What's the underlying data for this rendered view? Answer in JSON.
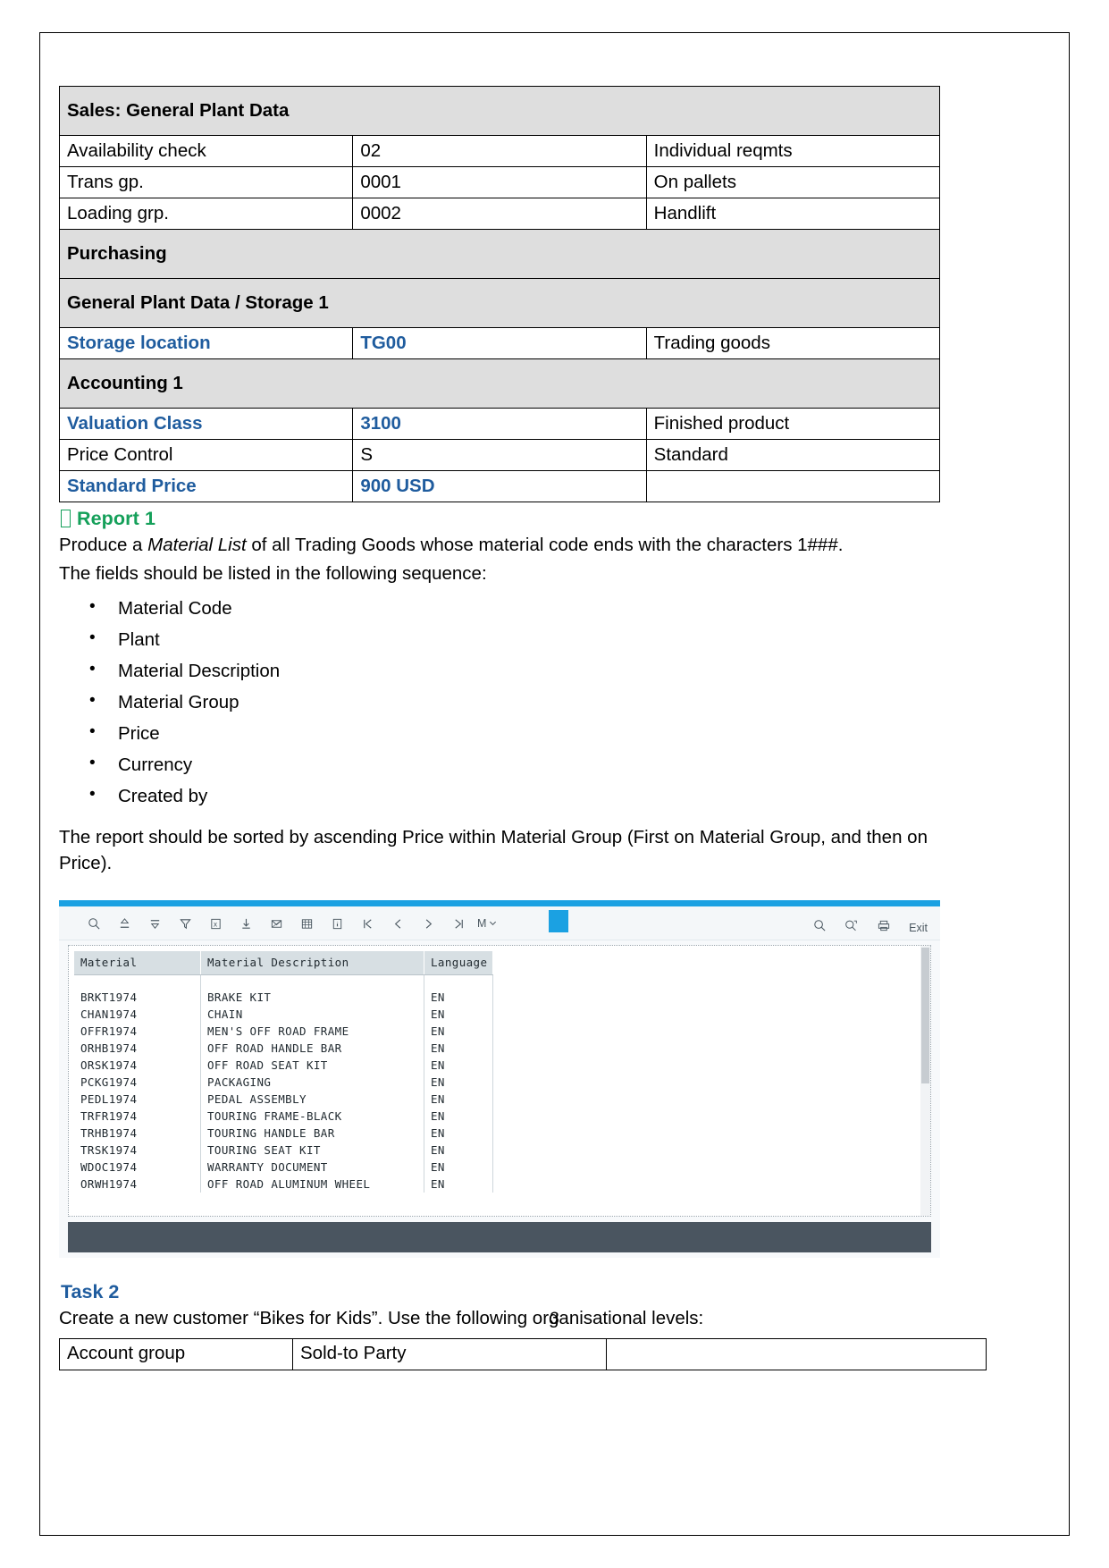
{
  "document": {
    "page_number": "3"
  },
  "plant_table": {
    "sections": {
      "sales": "Sales: General Plant Data",
      "purchasing": "Purchasing",
      "storage": "General Plant Data / Storage 1",
      "accounting": "Accounting 1"
    },
    "rows": [
      {
        "label": "Availability check",
        "value": "02",
        "desc": "Individual reqmts",
        "label_blue": false,
        "value_blue": false
      },
      {
        "label": "Trans gp.",
        "value": "0001",
        "desc": "On pallets",
        "label_blue": false,
        "value_blue": false
      },
      {
        "label": "Loading grp.",
        "value": "0002",
        "desc": "Handlift",
        "label_blue": false,
        "value_blue": false
      },
      {
        "label": "Storage location",
        "value": "TG00",
        "desc": "Trading goods",
        "label_blue": true,
        "value_blue": true
      },
      {
        "label": "Valuation Class",
        "value": "3100",
        "desc": "Finished product",
        "label_blue": true,
        "value_blue": true
      },
      {
        "label": "Price Control",
        "value": "S",
        "desc": "Standard",
        "label_blue": false,
        "value_blue": false
      },
      {
        "label": "Standard Price",
        "value": "900 USD",
        "desc": "",
        "label_blue": true,
        "value_blue": true
      }
    ]
  },
  "report": {
    "heading": "Report 1",
    "paragraph_line1_pre": "Produce a ",
    "paragraph_italic": "Material List",
    "paragraph_line1_post": " of all Trading Goods whose material code ends with the characters 1###.",
    "paragraph_line2": "The fields should be listed in the following sequence:",
    "fields": [
      "Material Code",
      "Plant",
      "Material Description",
      "Material Group",
      "Price",
      "Currency",
      "Created by"
    ],
    "sort_note": "The report should be sorted by ascending Price within Material Group (First on Material Group, and then on Price)."
  },
  "sap_screenshot": {
    "toolbar": {
      "more_label": "M",
      "exit_label": "Exit",
      "icons": [
        "magnifier-icon",
        "sort-ascending-icon",
        "sort-descending-icon",
        "filter-icon",
        "spreadsheet-icon",
        "download-icon",
        "mail-icon",
        "grid-icon",
        "info-icon",
        "first-page-icon",
        "previous-page-icon",
        "next-page-icon",
        "last-page-icon"
      ],
      "right_icons": [
        "search-icon",
        "search-next-icon",
        "print-icon"
      ]
    },
    "table": {
      "headers": [
        "Material",
        "Material Description",
        "Language"
      ],
      "rows": [
        [
          "BRKT1974",
          "BRAKE KIT",
          "EN"
        ],
        [
          "CHAN1974",
          "CHAIN",
          "EN"
        ],
        [
          "OFFR1974",
          "MEN'S OFF ROAD FRAME",
          "EN"
        ],
        [
          "ORHB1974",
          "OFF ROAD HANDLE BAR",
          "EN"
        ],
        [
          "ORSK1974",
          "OFF ROAD SEAT KIT",
          "EN"
        ],
        [
          "PCKG1974",
          "PACKAGING",
          "EN"
        ],
        [
          "PEDL1974",
          "PEDAL ASSEMBLY",
          "EN"
        ],
        [
          "TRFR1974",
          "TOURING FRAME-BLACK",
          "EN"
        ],
        [
          "TRHB1974",
          "TOURING HANDLE BAR",
          "EN"
        ],
        [
          "TRSK1974",
          "TOURING SEAT KIT",
          "EN"
        ],
        [
          "WDOC1974",
          "WARRANTY DOCUMENT",
          "EN"
        ],
        [
          "ORWH1974",
          "OFF ROAD ALUMINUM WHEEL",
          "EN"
        ]
      ]
    }
  },
  "task2": {
    "heading": "Task 2",
    "intro": "Create a new customer “Bikes for Kids”. Use the following organisational levels:",
    "row": {
      "label": "Account group",
      "value": "Sold-to Party",
      "extra": ""
    }
  },
  "colors": {
    "blue": "#1f5c9e",
    "green": "#15a05a",
    "section_grey": "#dedede",
    "sap_accent": "#1ba1e2",
    "sap_footer": "#4a5560"
  }
}
